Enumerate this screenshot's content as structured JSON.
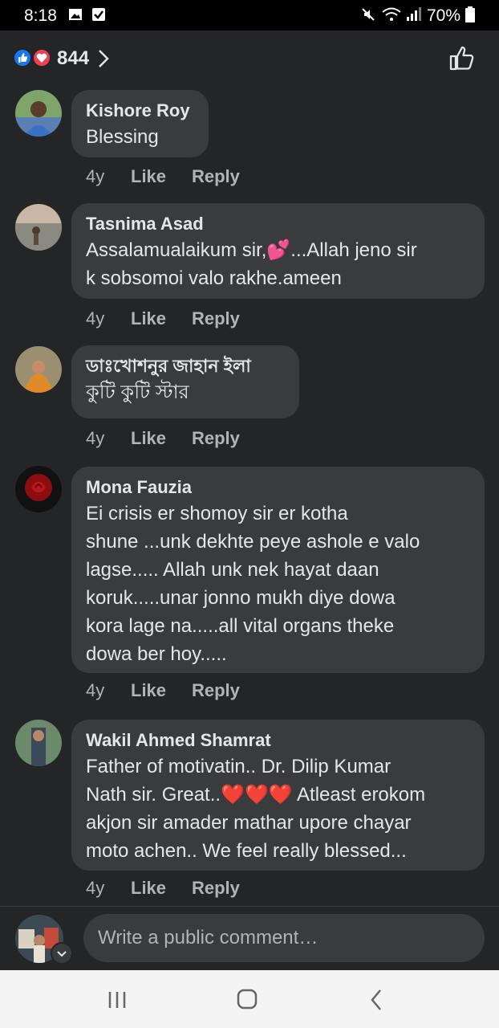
{
  "status": {
    "time": "8:18",
    "battery_pct": "70%",
    "left_icons": [
      "image-icon",
      "checkbox-icon"
    ],
    "right_icons": [
      "mute-icon",
      "wifi-icon",
      "signal-icon",
      "battery-icon"
    ]
  },
  "reactions": {
    "count": "844",
    "icons": [
      "like-reaction-icon",
      "love-reaction-icon",
      "chevron-right-icon",
      "thumbs-up-icon"
    ]
  },
  "comments": [
    {
      "author": "Kishore Roy",
      "lines": [
        "Blessing"
      ],
      "age": "4y",
      "like": "Like",
      "reply": "Reply"
    },
    {
      "author": "Tasnima Asad",
      "lines": [
        "Assalamualaikum sir,💕...Allah jeno sir",
        "k sobsomoi valo rakhe.ameen"
      ],
      "age": "4y",
      "like": "Like",
      "reply": "Reply"
    },
    {
      "author": "ডাঃখোশনুর জাহান ইলা",
      "lines": [
        "কুটি কুটি স্টার"
      ],
      "age": "4y",
      "like": "Like",
      "reply": "Reply"
    },
    {
      "author": "Mona Fauzia",
      "lines": [
        "Ei crisis er shomoy sir er kotha",
        "shune ...unk dekhte peye ashole e valo",
        "lagse..... Allah unk nek hayat daan",
        "koruk.....unar jonno mukh diye dowa",
        "kora lage na.....all vital organs theke",
        "dowa ber hoy....."
      ],
      "age": "4y",
      "like": "Like",
      "reply": "Reply"
    },
    {
      "author": "Wakil Ahmed Shamrat",
      "lines": [
        "Father of motivatin.. Dr. Dilip Kumar",
        "Nath sir. Great..❤️❤️❤️ Atleast erokom",
        "akjon sir amader mathar upore chayar",
        "moto achen.. We feel really blessed..."
      ],
      "age": "4y",
      "like": "Like",
      "reply": "Reply"
    }
  ],
  "composer": {
    "placeholder": "Write a public comment…"
  },
  "nav": {
    "icons": [
      "recents-icon",
      "home-icon",
      "back-icon"
    ]
  },
  "colors": {
    "background": "#242527",
    "bubble": "#3a3b3c",
    "like_blue": "#1877f2",
    "love_red": "#f33e58",
    "meta_gray": "#b0b3b8"
  }
}
